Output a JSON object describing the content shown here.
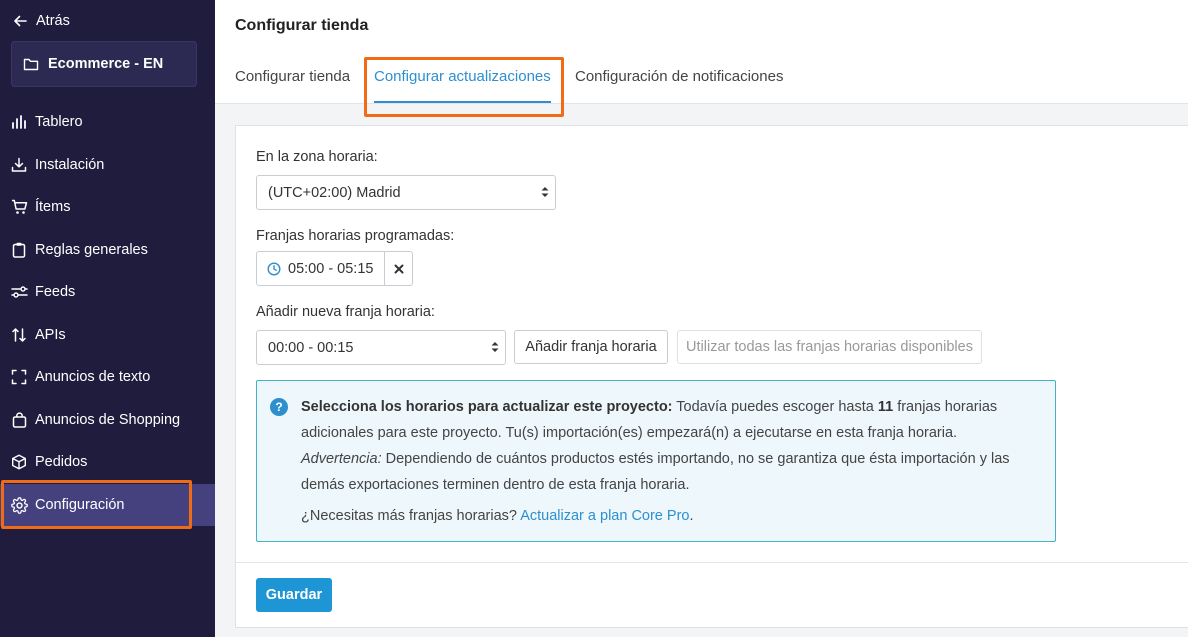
{
  "sidebar": {
    "back_label": "Atrás",
    "project_name": "Ecommerce - EN",
    "items": [
      {
        "label": "Tablero",
        "icon": "bar-chart-icon"
      },
      {
        "label": "Instalación",
        "icon": "download-tray-icon"
      },
      {
        "label": "Ítems",
        "icon": "cart-icon"
      },
      {
        "label": "Reglas generales",
        "icon": "clipboard-icon"
      },
      {
        "label": "Feeds",
        "icon": "sliders-icon"
      },
      {
        "label": "APIs",
        "icon": "sort-arrows-icon"
      },
      {
        "label": "Anuncios de texto",
        "icon": "corners-icon"
      },
      {
        "label": "Anuncios de Shopping",
        "icon": "shopping-bag-icon"
      },
      {
        "label": "Pedidos",
        "icon": "box-icon"
      },
      {
        "label": "Configuración",
        "icon": "gear-icon",
        "active": true
      }
    ]
  },
  "header": {
    "title": "Configurar tienda",
    "tabs": [
      {
        "label": "Configurar tienda"
      },
      {
        "label": "Configurar actualizaciones",
        "active": true
      },
      {
        "label": "Configuración de notificaciones"
      }
    ]
  },
  "form": {
    "timezone_label": "En la zona horaria:",
    "timezone_value": "(UTC+02:00) Madrid",
    "scheduled_label": "Franjas horarias programadas:",
    "scheduled_slot": "05:00 - 05:15",
    "add_label": "Añadir nueva franja horaria:",
    "add_value": "00:00 - 00:15",
    "add_button": "Añadir franja horaria",
    "use_all_button": "Utilizar todas las franjas horarias disponibles"
  },
  "info": {
    "heading": "Selecciona los horarios para actualizar este proyecto:",
    "text_before_count": "Todavía puedes escoger hasta",
    "count": "11",
    "text_after_count": "franjas horarias adicionales para este proyecto. Tu(s) importación(es) empezará(n) a ejecutarse en esta franja horaria.",
    "warning_label": "Advertencia:",
    "warning_text": "Dependiendo de cuántos productos estés importando, no se garantiza que ésta importación y las demás exportaciones terminen dentro de esta franja horaria.",
    "footer_text": "¿Necesitas más franjas horarias?",
    "upgrade_link": "Actualizar a plan Core Pro",
    "footer_end": "."
  },
  "save_button": "Guardar",
  "colors": {
    "sidebar_bg": "#1f1c3d",
    "sidebar_active": "#45407e",
    "accent": "#2e8fcf",
    "highlight": "#f06b16",
    "save_button": "#1e96d6"
  }
}
